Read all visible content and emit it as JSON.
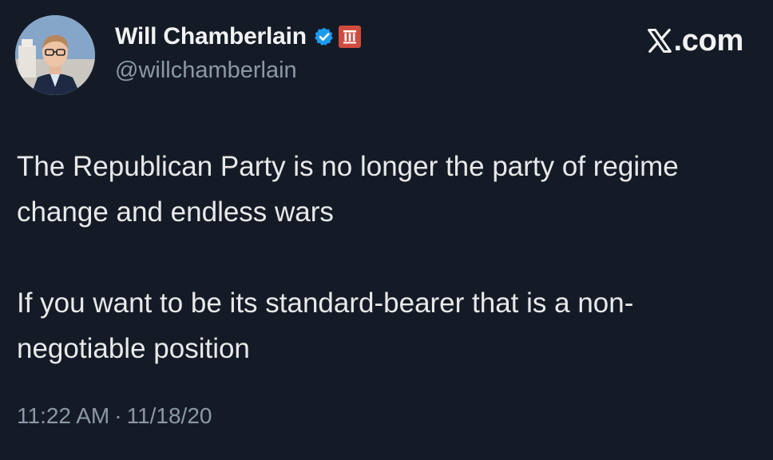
{
  "author": {
    "display_name": "Will Chamberlain",
    "handle": "@willchamberlain",
    "avatar_icon": "profile-photo",
    "verified_icon": "verified-badge-icon",
    "affiliation_icon": "columns-badge-icon"
  },
  "site": {
    "logo_icon": "x-logo-icon",
    "suffix": ".com"
  },
  "tweet": {
    "paragraphs": [
      "The Republican Party is no longer the party of regime change and endless wars",
      "If you want to be its standard-bearer that is a non-negotiable position"
    ],
    "time": "11:22 AM",
    "separator": "·",
    "date": "11/18/20"
  },
  "colors": {
    "background": "#151b26",
    "text_primary": "#e7e9ea",
    "text_secondary": "#8b98a5",
    "verified_blue": "#1d9bf0",
    "affiliation_red": "#d14b3f"
  }
}
